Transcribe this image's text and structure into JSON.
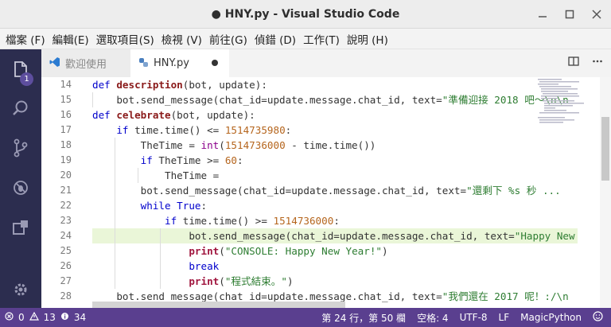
{
  "window": {
    "title": "● HNY.py - Visual Studio Code"
  },
  "menu": [
    "檔案 (F)",
    "編輯(E)",
    "選取項目(S)",
    "檢視 (V)",
    "前往(G)",
    "偵錯 (D)",
    "工作(T)",
    "說明 (H)"
  ],
  "activity": {
    "explorer_badge": "1"
  },
  "tabs": [
    {
      "label": "歡迎使用"
    },
    {
      "label": "HNY.py"
    }
  ],
  "editor": {
    "line_numbers": [
      "14",
      "15",
      "16",
      "17",
      "18",
      "19",
      "20",
      "21",
      "22",
      "23",
      "24",
      "25",
      "26",
      "27",
      "28"
    ],
    "lines": [
      [
        [
          "kw",
          "def "
        ],
        [
          "fn",
          "description"
        ],
        [
          "plain",
          "("
        ],
        [
          "plain",
          "bot"
        ],
        [
          "plain",
          ", update):"
        ]
      ],
      [
        [
          "plain",
          "    bot.send_message(chat_id=update.message.chat_id, text="
        ],
        [
          "str",
          "\"準備迎接 2018 吧～\\n\\n"
        ]
      ],
      [
        [
          "kw",
          "def "
        ],
        [
          "fn",
          "celebrate"
        ],
        [
          "plain",
          "(bot, update):"
        ]
      ],
      [
        [
          "plain",
          "    "
        ],
        [
          "kw",
          "if "
        ],
        [
          "plain",
          "time.time() <= "
        ],
        [
          "num",
          "1514735980"
        ],
        [
          "plain",
          ":"
        ]
      ],
      [
        [
          "plain",
          "        TheTime = "
        ],
        [
          "bi",
          "int"
        ],
        [
          "plain",
          "("
        ],
        [
          "num",
          "1514736000"
        ],
        [
          "plain",
          " - time.time())"
        ]
      ],
      [
        [
          "plain",
          "        "
        ],
        [
          "kw",
          "if "
        ],
        [
          "plain",
          "TheTime >= "
        ],
        [
          "num",
          "60"
        ],
        [
          "plain",
          ":"
        ]
      ],
      [
        [
          "plain",
          "            TheTime = "
        ]
      ],
      [
        [
          "plain",
          "        bot.send_message(chat_id=update.message.chat_id, text="
        ],
        [
          "str",
          "\"還剩下 %s 秒 ..."
        ]
      ],
      [
        [
          "plain",
          "        "
        ],
        [
          "kw",
          "while "
        ],
        [
          "kw",
          "True"
        ],
        [
          "plain",
          ":"
        ]
      ],
      [
        [
          "plain",
          "            "
        ],
        [
          "kw",
          "if "
        ],
        [
          "plain",
          "time.time() >= "
        ],
        [
          "num",
          "1514736000"
        ],
        [
          "plain",
          ":"
        ]
      ],
      [
        [
          "plain",
          "                bot.send_message(chat_id=update.message.chat_id, text="
        ],
        [
          "str",
          "\"Happy New"
        ]
      ],
      [
        [
          "plain",
          "                "
        ],
        [
          "pr",
          "print"
        ],
        [
          "plain",
          "("
        ],
        [
          "str",
          "\"CONSOLE: Happy New Year!\""
        ],
        [
          "plain",
          ")"
        ]
      ],
      [
        [
          "plain",
          "                "
        ],
        [
          "kw",
          "break"
        ]
      ],
      [
        [
          "plain",
          "                "
        ],
        [
          "pr",
          "print"
        ],
        [
          "plain",
          "("
        ],
        [
          "str",
          "\"程式結束。\""
        ],
        [
          "plain",
          ")"
        ]
      ],
      [
        [
          "plain",
          "    bot.send_message(chat_id=update.message.chat_id, text="
        ],
        [
          "str",
          "\"我們還在 2017 呢！:/\\n"
        ]
      ]
    ]
  },
  "status": {
    "errors": "0",
    "warnings": "13",
    "info": "34",
    "position": "第 24 行，第 50 欄",
    "spaces": "空格: 4",
    "encoding": "UTF-8",
    "eol": "LF",
    "language": "MagicPython"
  }
}
